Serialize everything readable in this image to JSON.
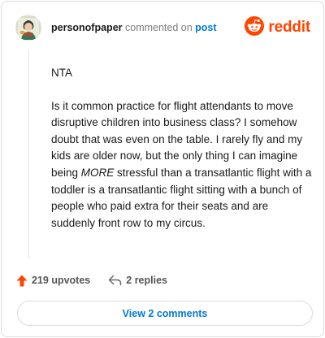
{
  "header": {
    "username": "personofpaper",
    "action_text": " commented on ",
    "target_link": "post",
    "brand": "reddit"
  },
  "comment": {
    "paragraphs": [
      {
        "text": "NTA"
      },
      {
        "before": "Is it common practice for flight attendants to move disruptive children into business class? I somehow doubt that was even on the table. I rarely fly and my kids are older now, but the only thing I can imagine being ",
        "emphasis": "MORE",
        "after": " stressful than a transatlantic flight with a toddler is a transatlantic flight sitting with a bunch of people who paid extra for their seats and are suddenly front row to my circus."
      }
    ]
  },
  "actions": {
    "upvotes_label": "219 upvotes",
    "replies_label": "2 replies"
  },
  "view_comments_label": "View 2 comments",
  "colors": {
    "brand": "#ff4500",
    "link": "#0079d3",
    "upvote_arrow": "#ff4500"
  }
}
